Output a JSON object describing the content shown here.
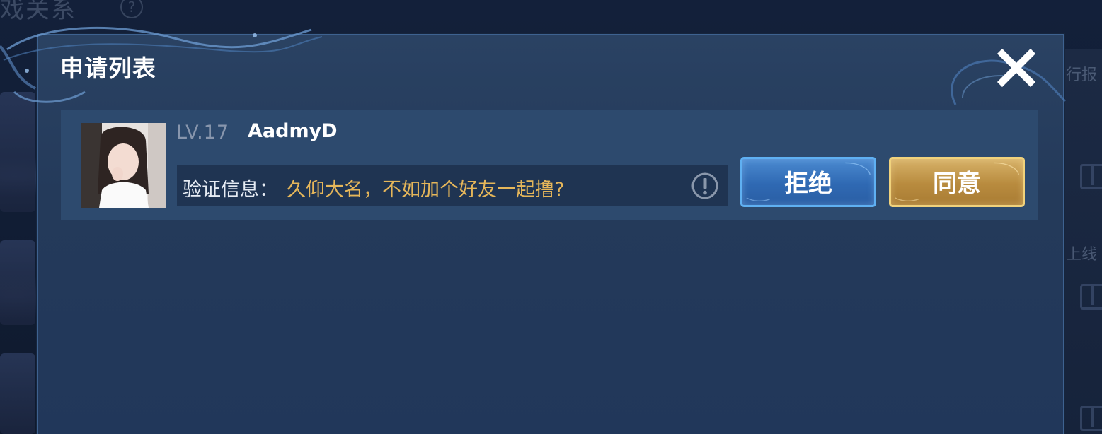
{
  "background": {
    "title": "戏关系",
    "help_glyph": "?",
    "right_labels": [
      "行报",
      "上线"
    ]
  },
  "dialog": {
    "title": "申请列表",
    "close_icon": "close-x-icon"
  },
  "requests": [
    {
      "level": "LV.17",
      "name": "AadmyD",
      "verify_label": "验证信息：",
      "verify_message": "久仰大名，不如加个好友一起撸?",
      "reject_label": "拒绝",
      "accept_label": "同意"
    }
  ],
  "colors": {
    "accent_gold": "#e5b65a",
    "reject_blue": "#2f69b3",
    "accept_gold": "#b88b3e",
    "dialog_bg": "#243a5a"
  }
}
